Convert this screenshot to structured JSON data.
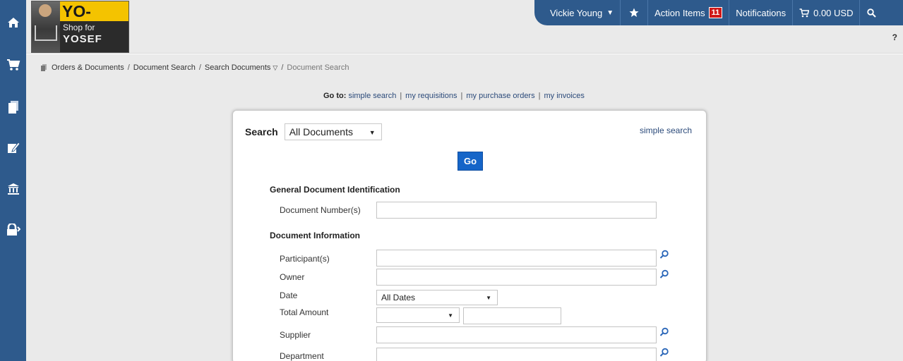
{
  "sidebar": {
    "items": [
      {
        "icon": "home-icon"
      },
      {
        "icon": "cart-icon"
      },
      {
        "icon": "documents-icon"
      },
      {
        "icon": "edit-icon"
      },
      {
        "icon": "bank-icon"
      },
      {
        "icon": "lock-icon"
      }
    ]
  },
  "logo": {
    "top_text": "YO-MART",
    "line1": "Shop for",
    "line2": "YOSEF"
  },
  "topbar": {
    "user": "Vickie Young",
    "action_items_label": "Action Items",
    "action_items_count": "11",
    "notifications_label": "Notifications",
    "cart_amount": "0.00 USD",
    "help": "?"
  },
  "breadcrumb": {
    "items": [
      "Orders & Documents",
      "Document Search",
      "Search Documents",
      "Document Search"
    ]
  },
  "goto": {
    "label": "Go to:",
    "links": [
      "simple search",
      "my requisitions",
      "my purchase orders",
      "my invoices"
    ]
  },
  "search": {
    "label": "Search",
    "selected": "All Documents",
    "simple_search_link": "simple search",
    "go_label": "Go"
  },
  "sections": {
    "general": "General Document Identification",
    "info": "Document Information"
  },
  "fields": {
    "document_numbers": "Document Number(s)",
    "participants": "Participant(s)",
    "owner": "Owner",
    "date": "Date",
    "date_selected": "All Dates",
    "total_amount": "Total Amount",
    "supplier": "Supplier",
    "department": "Department"
  },
  "colors": {
    "brand_blue": "#2e5a8c",
    "go_button": "#1565c8",
    "badge_red": "#d01818",
    "logo_yellow": "#f4c300"
  }
}
